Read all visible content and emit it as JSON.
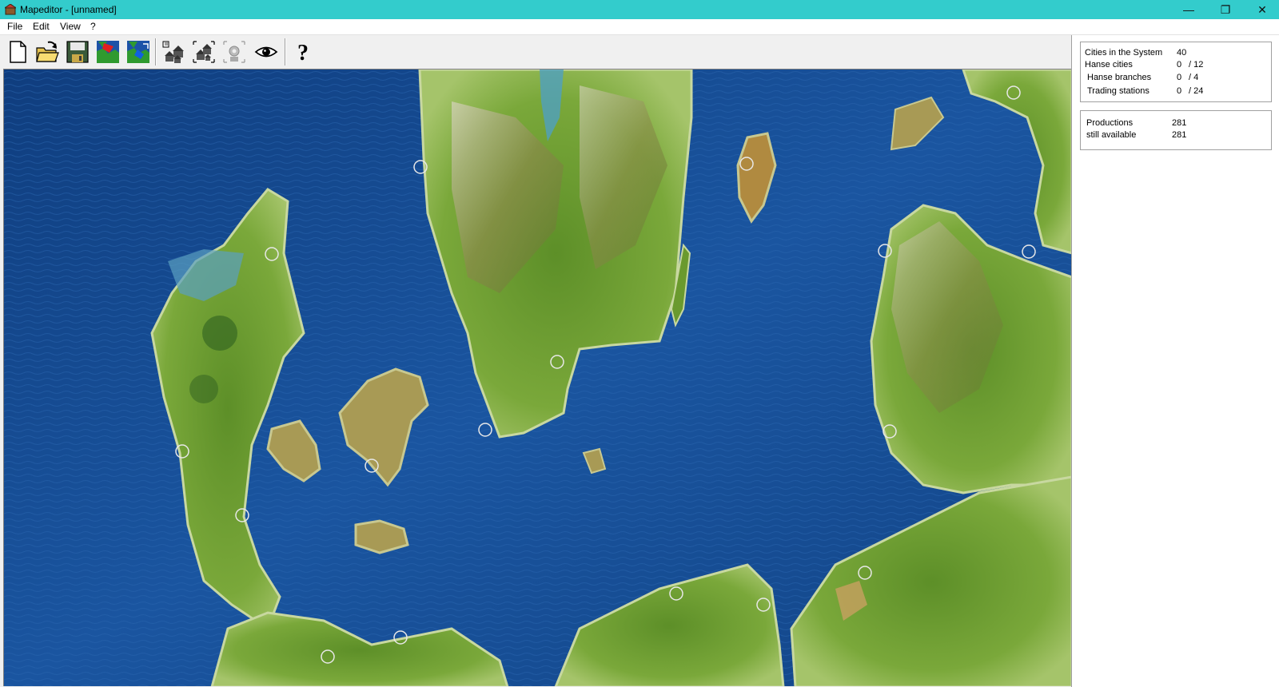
{
  "window": {
    "title": "Mapeditor - [unnamed]",
    "minimize": "—",
    "restore": "❐",
    "close": "✕"
  },
  "menu": [
    "File",
    "Edit",
    "View",
    "?"
  ],
  "toolbar": {
    "buttons": [
      {
        "name": "new-file-icon"
      },
      {
        "name": "open-folder-icon"
      },
      {
        "name": "save-disk-icon"
      },
      {
        "name": "map-red-icon"
      },
      {
        "name": "map-blue-icon"
      },
      {
        "name": "place-city-icon"
      },
      {
        "name": "move-city-icon"
      },
      {
        "name": "city-settings-icon"
      },
      {
        "name": "eye-view-icon"
      },
      {
        "name": "help-icon"
      }
    ],
    "help_label": "?"
  },
  "stats": {
    "cities_label": "Cities in the System",
    "cities_value": "40",
    "hanse_cities_label": "Hanse cities",
    "hanse_cities_value": "0",
    "hanse_cities_max": "/ 12",
    "hanse_branches_label": "Hanse branches",
    "hanse_branches_value": "0",
    "hanse_branches_max": "/ 4",
    "trading_stations_label": "Trading stations",
    "trading_stations_value": "0",
    "trading_stations_max": "/ 24"
  },
  "productions": {
    "productions_label": "Productions",
    "productions_value": "281",
    "available_label": "still available",
    "available_value": "281"
  },
  "colors": {
    "titlebar": "#33cccc",
    "sea": "#13407d",
    "land": "#6a9a2e",
    "mountain": "#a39a6a"
  }
}
